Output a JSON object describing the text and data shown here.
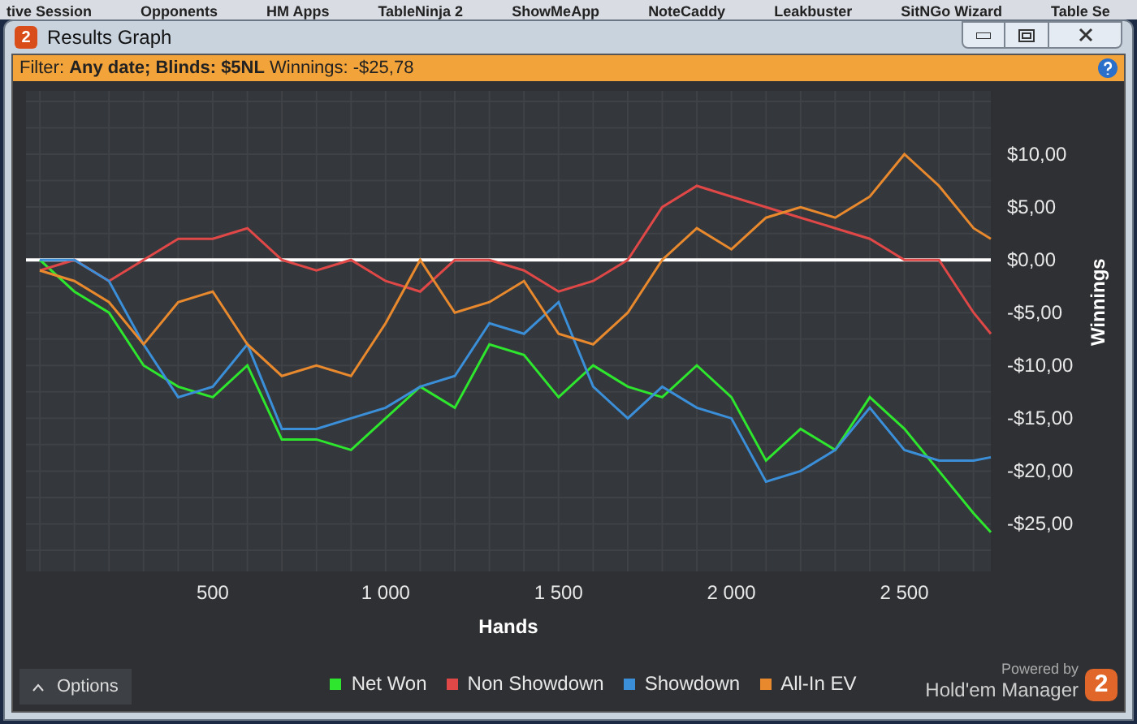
{
  "background_menu": [
    "tive Session",
    "Opponents",
    "HM Apps",
    "TableNinja 2",
    "ShowMeApp",
    "NoteCaddy",
    "Leakbuster",
    "SitNGo Wizard",
    "Table Se"
  ],
  "window": {
    "logo": "2",
    "title": "Results Graph"
  },
  "filter_bar": {
    "text": "Filter: **Any date; Blinds: $5NL** Winnings: -$25,78"
  },
  "chart": {
    "chart_data": {
      "type": "line",
      "xlabel": "Hands",
      "ylabel": "Winnings",
      "x": [
        0,
        100,
        200,
        300,
        400,
        500,
        600,
        700,
        800,
        900,
        1000,
        1100,
        1200,
        1300,
        1400,
        1500,
        1600,
        1700,
        1800,
        1900,
        2000,
        2100,
        2200,
        2300,
        2400,
        2500,
        2600,
        2700,
        2750
      ],
      "series": [
        {
          "name": "Net Won",
          "color": "#2ee62e",
          "values": [
            0,
            -3,
            -5,
            -10,
            -12,
            -13,
            -10,
            -17,
            -17,
            -18,
            -15,
            -12,
            -14,
            -8,
            -9,
            -13,
            -10,
            -12,
            -13,
            -10,
            -13,
            -19,
            -16,
            -18,
            -13,
            -16,
            -20,
            -24,
            -25.8
          ]
        },
        {
          "name": "Non Showdown",
          "color": "#e04848",
          "values": [
            -1,
            0,
            -2,
            0,
            2,
            2,
            3,
            0,
            -1,
            0,
            -2,
            -3,
            0,
            0,
            -1,
            -3,
            -2,
            0,
            5,
            7,
            6,
            5,
            4,
            3,
            2,
            0,
            0,
            -5,
            -7
          ]
        },
        {
          "name": "Showdown",
          "color": "#3b8fd9",
          "values": [
            0,
            0,
            -2,
            -8,
            -13,
            -12,
            -8,
            -16,
            -16,
            -15,
            -14,
            -12,
            -11,
            -6,
            -7,
            -4,
            -12,
            -15,
            -12,
            -14,
            -15,
            -21,
            -20,
            -18,
            -14,
            -18,
            -19,
            -19,
            -18.7
          ]
        },
        {
          "name": "All-In EV",
          "color": "#e8892e",
          "values": [
            -1,
            -2,
            -4,
            -8,
            -4,
            -3,
            -8,
            -11,
            -10,
            -11,
            -6,
            0,
            -5,
            -4,
            -2,
            -7,
            -8,
            -5,
            0,
            3,
            1,
            4,
            5,
            4,
            6,
            10,
            7,
            3,
            2
          ]
        }
      ],
      "grid": true,
      "xlim": [
        -40,
        2750
      ],
      "ylim": [
        -29.5,
        16
      ],
      "xticks": [
        {
          "value": 500,
          "label": "500"
        },
        {
          "value": 1000,
          "label": "1 000"
        },
        {
          "value": 1500,
          "label": "1 500"
        },
        {
          "value": 2000,
          "label": "2 000"
        },
        {
          "value": 2500,
          "label": "2 500"
        }
      ],
      "yticks": [
        {
          "value": 10,
          "label": "$10,00"
        },
        {
          "value": 5,
          "label": "$5,00"
        },
        {
          "value": 0,
          "label": "$0,00"
        },
        {
          "value": -5,
          "label": "-$5,00"
        },
        {
          "value": -10,
          "label": "-$10,00"
        },
        {
          "value": -15,
          "label": "-$15,00"
        },
        {
          "value": -20,
          "label": "-$20,00"
        },
        {
          "value": -25,
          "label": "-$25,00"
        }
      ]
    }
  },
  "options_button": {
    "label": "Options"
  },
  "branding": {
    "powered_by": "Powered by",
    "product": "Hold'em Manager",
    "logo": "2"
  }
}
